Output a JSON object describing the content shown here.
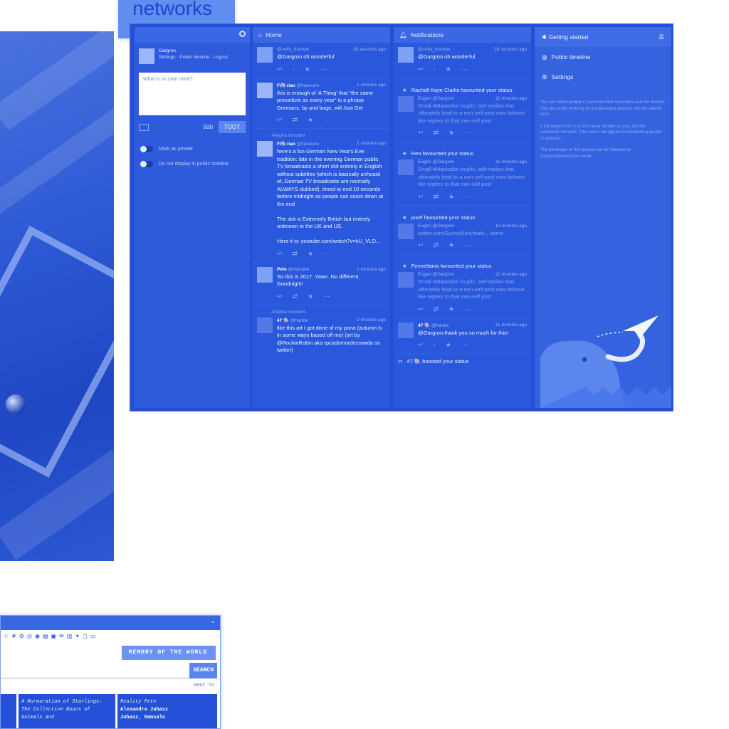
{
  "heading": "networks",
  "compose": {
    "user_name": "Gargron",
    "user_links": "Settings · Public timeline · Logout",
    "placeholder": "What is on your mind?",
    "char_count": "500",
    "toot_label": "TOOT",
    "private_label": "Mark as private",
    "unlisted_label": "Do not display in public timeline"
  },
  "home": {
    "title": "Home",
    "statuses": [
      {
        "boost": "",
        "name": "",
        "handle": "@ceflo_thomps",
        "time": "28 seconds ago",
        "text": "@Gargron oh wonderful"
      },
      {
        "boost": "",
        "name": "Fl🐘rian",
        "handle": "@flaneurie",
        "time": "1 minutes ago",
        "text": "this is enough of 'A Thing' that \"the same procedure as every year\" is a phrase Germans, by and large, will Just Get"
      },
      {
        "boost": "Akepha boosted",
        "name": "Fl🐘rian",
        "handle": "@flaneurie",
        "time": "2 minutes ago",
        "text": "here's a fun German New Year's Eve tradition: late in the evening German public TV broadcasts a short skit entirely in English without subtitles (which is basically unheard of, German TV broadcasts are normally ALWAYS dubbed), timed to end 10 seconds before midnight so people can count down at the end\n\nThe skit is Extremely British but entirely unknown in the UK and US.\n\nHere it is: youtube.com/watch?v=kU_VLO..."
      },
      {
        "boost": "",
        "name": "Pete",
        "handle": "@rayvade",
        "time": "1 minutes ago",
        "text": "So this is 2017. Yawn. No different. Goodnight!"
      },
      {
        "boost": "Akepha boosted",
        "name": "47 🐘",
        "handle": "@hanbe",
        "time": "2 minutes ago",
        "text": "like this art I got done of my pona (autumn is in some ways based off me) (art by @RockinRobin aka rpcadamordecrowda on twitter)"
      }
    ]
  },
  "notifications": {
    "title": "Notifications",
    "items": [
      {
        "kind": "status",
        "line": "",
        "name": "",
        "handle": "@ceflo_thomps",
        "time": "28 seconds ago",
        "text": "@Gargron oh wonderful",
        "faded": false
      },
      {
        "kind": "fav",
        "line": "Rachell Kaye Clarke favourited your status",
        "name": "Eugen @Gargron",
        "handle": "",
        "time": "11 minutes ago",
        "text": "Small #Mastodon bugfix: self-replies that ultimately lead to a non-self post now behave like replies to that non-self post",
        "faded": true
      },
      {
        "kind": "fav",
        "line": "Ren favourited your status",
        "name": "Eugen @Gargron",
        "handle": "",
        "time": "11 minutes ago",
        "text": "Small #Mastodon bugfix: self-replies that ultimately lead to a non-self post now behave like replies to that non-self post",
        "faded": true
      },
      {
        "kind": "fav",
        "line": "josef favourited your status",
        "name": "Eugen @Gargron",
        "handle": "",
        "time": "10 minutes ago",
        "text": "twitter.com/SunnyMew/statu... some",
        "faded": true
      },
      {
        "kind": "fav",
        "line": "Fennellania favourited your status",
        "name": "Eugen @Gargron",
        "handle": "",
        "time": "11 minutes ago",
        "text": "Small #Mastodon bugfix: self-replies that ultimately lead to a non-self post now behave like replies to that non-self post",
        "faded": true
      },
      {
        "kind": "status",
        "line": "",
        "name": "47 🐘",
        "handle": "@hanbe",
        "time": "11 minutes ago",
        "text": "@Gargron thank you so much for this!",
        "faded": false
      },
      {
        "kind": "boost",
        "line": "47 🐘 boosted your status",
        "name": "",
        "handle": "",
        "time": "",
        "text": "",
        "faded": false
      }
    ]
  },
  "getting_started": {
    "title": "Getting started",
    "items": [
      {
        "icon": "globe-icon",
        "label": "Public timeline"
      },
      {
        "icon": "gear-icon",
        "label": "Settings"
      }
    ],
    "hints": [
      "You can follow people if you know their username and the domain they are on by entering an e-mail-esque address into the search form.",
      "If the target user is on the same domain as you, just the username will work. The same rule applies to mentioning people in statuses.",
      "The developer of this project can be followed as Gargron@mastodon.social"
    ]
  },
  "browser": {
    "banner": "MEMORY OF THE WORLD",
    "search_label": "SEARCH",
    "next_label": "next >>",
    "cards": [
      {
        "title": "A Murmuration of Starlings: The Collective Nouns of Animals and",
        "author": ""
      },
      {
        "title": "Reality Fete",
        "author": "Alexandra Juhasz\nJuhasz, Gamsalo"
      }
    ]
  },
  "colors": {
    "accent": "#2350d6",
    "banner": "#6c93f1"
  }
}
